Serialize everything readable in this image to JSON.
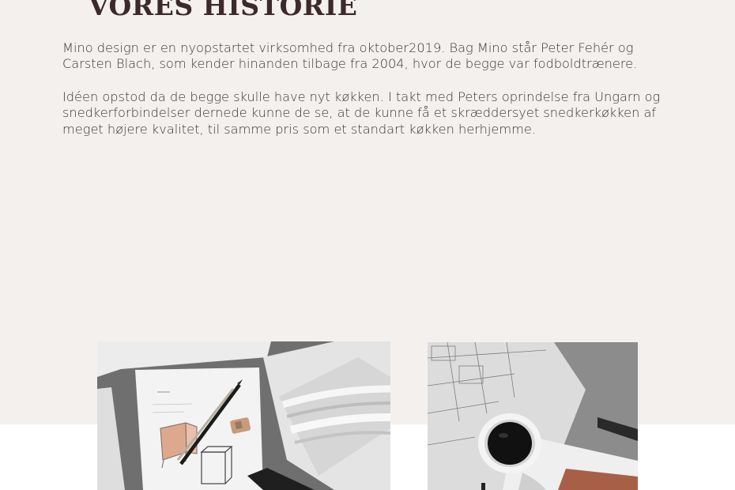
{
  "section": {
    "title": "VORES HISTORIE",
    "paragraphs": [
      "Mino design er en nyopstartet virksomhed fra oktober2019. Bag Mino står Peter Fehér og Carsten Blach, som kender hinanden tilbage fra 2004, hvor de begge var fodboldtrænere.",
      "Idéen opstod da de begge skulle have nyt køkken.  I takt med Peters oprindelse fra Ungarn og snedkerforbindelser dernede kunne de se, at de kunne få et skræddersyet snedkerkøkken af meget højere kvalitet, til samme pris som et standart køkken herhjemme."
    ]
  },
  "images": [
    {
      "name": "design-sketch-photo"
    },
    {
      "name": "coffee-blueprint-photo"
    }
  ],
  "colors": {
    "band": "#f4f0ed",
    "heading": "#3c2a2a",
    "text": "#3d3535"
  }
}
